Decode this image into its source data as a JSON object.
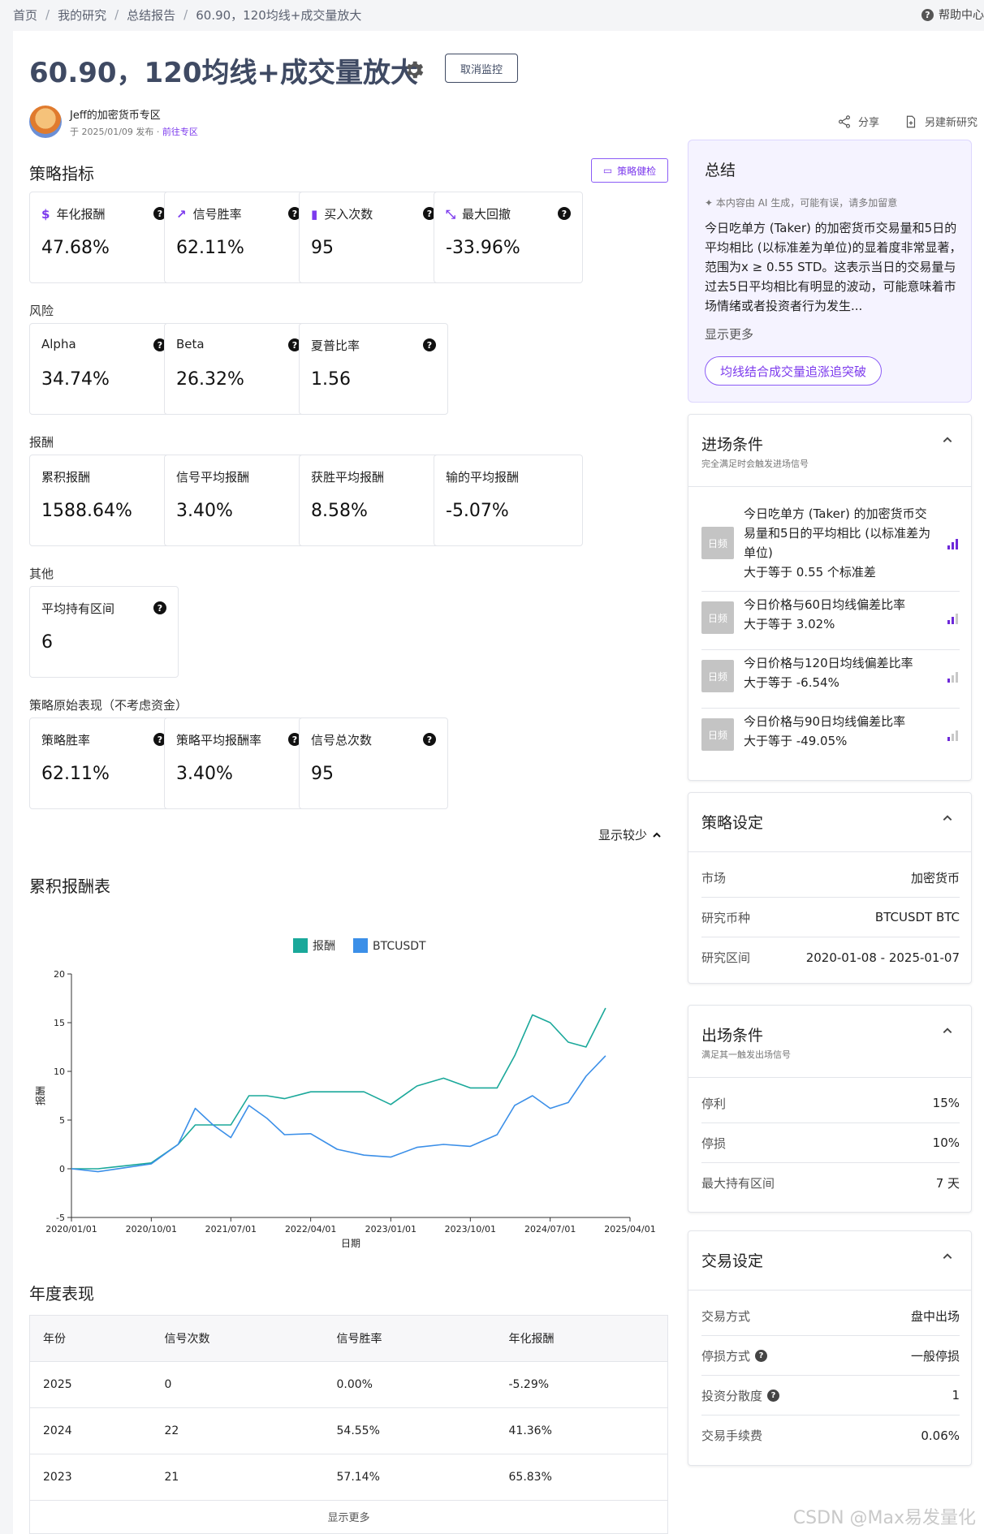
{
  "breadcrumb": [
    "首页",
    "我的研究",
    "总结报告",
    "60.90，120均线+成交量放大"
  ],
  "help": "帮助中心",
  "title": "60.90，120均线+成交量放大",
  "cancel_label": "取消监控",
  "author": {
    "name": "Jeff的加密货币专区",
    "date": "于 2025/01/09 发布",
    "dot": "·",
    "link": "前往专区"
  },
  "actions": {
    "share": "分享",
    "new_research": "另建新研究"
  },
  "sections": {
    "metrics": "策略指标",
    "risk": "风险",
    "return": "报酬",
    "other": "其他",
    "raw": "策略原始表现（不考虑资金）",
    "cumulative": "累积报酬表",
    "annual": "年度表现"
  },
  "health_label": "策略健检",
  "metrics": [
    {
      "label": "年化报酬",
      "value": "47.68%",
      "icon": "$"
    },
    {
      "label": "信号胜率",
      "value": "62.11%",
      "icon": "↗"
    },
    {
      "label": "买入次数",
      "value": "95",
      "icon": "▮"
    },
    {
      "label": "最大回撤",
      "value": "-33.96%",
      "icon": "⤡"
    }
  ],
  "risk": [
    {
      "label": "Alpha",
      "value": "34.74%"
    },
    {
      "label": "Beta",
      "value": "26.32%"
    },
    {
      "label": "夏普比率",
      "value": "1.56"
    }
  ],
  "returns": [
    {
      "label": "累积报酬",
      "value": "1588.64%"
    },
    {
      "label": "信号平均报酬",
      "value": "3.40%"
    },
    {
      "label": "获胜平均报酬",
      "value": "8.58%"
    },
    {
      "label": "输的平均报酬",
      "value": "-5.07%"
    }
  ],
  "other": [
    {
      "label": "平均持有区间",
      "value": "6"
    }
  ],
  "raw": [
    {
      "label": "策略胜率",
      "value": "62.11%"
    },
    {
      "label": "策略平均报酬率",
      "value": "3.40%"
    },
    {
      "label": "信号总次数",
      "value": "95"
    }
  ],
  "show_less": "显示较少",
  "chart_data": {
    "type": "line",
    "xlabel": "日期",
    "ylabel": "报酬",
    "ylim": [
      -5,
      20
    ],
    "yticks": [
      "-5",
      "0",
      "5",
      "10",
      "15",
      "20"
    ],
    "xticks": [
      "2020/01/01",
      "2020/10/01",
      "2021/07/01",
      "2022/04/01",
      "2023/01/01",
      "2023/10/01",
      "2024/07/01",
      "2025/04/01"
    ],
    "x": [
      "2020/01/01",
      "2020/04/01",
      "2020/07/01",
      "2020/10/01",
      "2021/01/01",
      "2021/03/01",
      "2021/05/01",
      "2021/07/01",
      "2021/09/01",
      "2021/11/01",
      "2022/01/01",
      "2022/04/01",
      "2022/07/01",
      "2022/10/01",
      "2023/01/01",
      "2023/04/01",
      "2023/07/01",
      "2023/10/01",
      "2024/01/01",
      "2024/03/01",
      "2024/05/01",
      "2024/07/01",
      "2024/09/01",
      "2024/11/01",
      "2025/01/07"
    ],
    "legend_position": "top-center",
    "series": [
      {
        "name": "报酬",
        "color": "#1aa89a",
        "values": [
          0,
          0,
          0.3,
          0.6,
          2.5,
          4.5,
          4.5,
          4.5,
          7.5,
          7.5,
          7.2,
          7.9,
          7.9,
          7.9,
          6.6,
          8.5,
          9.3,
          8.3,
          8.3,
          11.6,
          15.8,
          15.0,
          13.0,
          12.5,
          16.5
        ]
      },
      {
        "name": "BTCUSDT",
        "color": "#3b8fe8",
        "values": [
          0,
          -0.3,
          0.1,
          0.5,
          2.5,
          6.2,
          4.5,
          3.2,
          6.5,
          5.2,
          3.5,
          3.6,
          2.0,
          1.4,
          1.2,
          2.2,
          2.5,
          2.3,
          3.5,
          6.5,
          7.5,
          6.2,
          6.8,
          9.5,
          11.6
        ]
      }
    ]
  },
  "annual": {
    "headers": [
      "年份",
      "信号次数",
      "信号胜率",
      "年化报酬"
    ],
    "rows": [
      [
        "2025",
        "0",
        "0.00%",
        "-5.29%"
      ],
      [
        "2024",
        "22",
        "54.55%",
        "41.36%"
      ],
      [
        "2023",
        "21",
        "57.14%",
        "65.83%"
      ]
    ],
    "more": "显示更多"
  },
  "summary": {
    "title": "总结",
    "ai_note": "本内容由 AI 生成，可能有误，请多加留意",
    "text": "今日吃单方 (Taker) 的加密货币交易量和5日的平均相比 (以标准差为单位)的显着度非常显著，范围为x ≥ 0.55 STD。这表示当日的交易量与过去5日平均相比有明显的波动，可能意味着市场情绪或者投资者行为发生...",
    "more": "显示更多",
    "tag": "均线结合成交量追涨追突破"
  },
  "entry": {
    "title": "进场条件",
    "subtitle": "完全满足时会触发进场信号",
    "items": [
      {
        "badge": "日频",
        "text": "今日吃单方 (Taker) 的加密货币交易量和5日的平均相比 (以标准差为单位)",
        "cond": "大于等于 0.55 个标准差",
        "level": 3
      },
      {
        "badge": "日频",
        "text": "今日价格与60日均线偏差比率",
        "cond": "大于等于 3.02%",
        "level": 2
      },
      {
        "badge": "日频",
        "text": "今日价格与120日均线偏差比率",
        "cond": "大于等于 -6.54%",
        "level": 1
      },
      {
        "badge": "日频",
        "text": "今日价格与90日均线偏差比率",
        "cond": "大于等于 -49.05%",
        "level": 1
      }
    ]
  },
  "strategy": {
    "title": "策略设定",
    "rows": [
      [
        "市场",
        "加密货币"
      ],
      [
        "研究币种",
        "BTCUSDT BTC"
      ],
      [
        "研究区间",
        "2020-01-08 - 2025-01-07"
      ]
    ]
  },
  "exit": {
    "title": "出场条件",
    "subtitle": "满足其一触发出场信号",
    "rows": [
      [
        "停利",
        "15%"
      ],
      [
        "停损",
        "10%"
      ],
      [
        "最大持有区间",
        "7 天"
      ]
    ]
  },
  "trade": {
    "title": "交易设定",
    "rows": [
      [
        "交易方式",
        "盘中出场",
        false
      ],
      [
        "停损方式",
        "一般停损",
        true
      ],
      [
        "投资分散度",
        "1",
        true
      ],
      [
        "交易手续费",
        "0.06%",
        false
      ]
    ]
  },
  "watermark": "CSDN @Max易发量化",
  "colors": {
    "accent": "#7c3aed",
    "title": "#3f4a63"
  }
}
